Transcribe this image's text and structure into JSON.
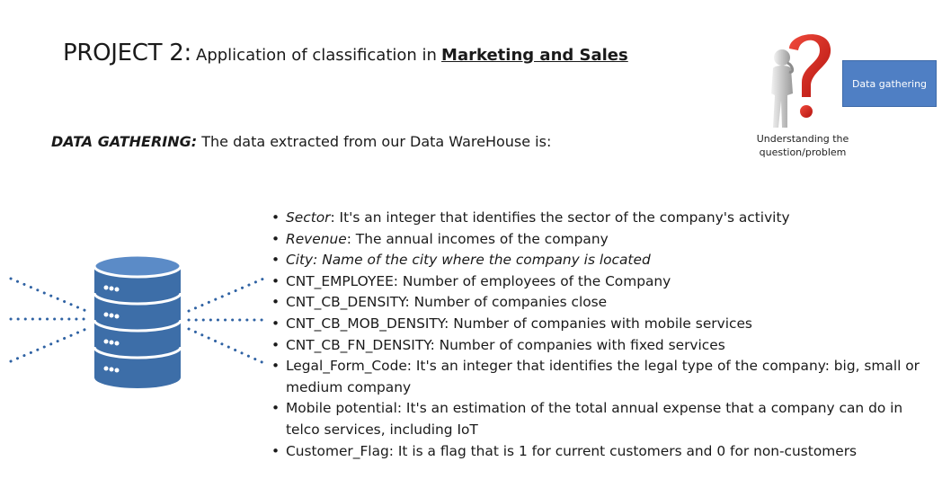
{
  "title": {
    "project": "PROJECT 2:",
    "prefix": "Application of classification in",
    "highlight": "Marketing and Sales"
  },
  "subtitle": {
    "lead": "DATA GATHERING:",
    "text": "The data extracted from our Data WareHouse is:"
  },
  "badge": {
    "label": "Data gathering"
  },
  "caption": {
    "line1": "Understanding the",
    "line2": "question/problem"
  },
  "colors": {
    "badge": "#4f7fc4",
    "database": "#3d6ea8",
    "question_mark": "#d7261e"
  },
  "icons": [
    "thinker-question-icon",
    "database-icon"
  ],
  "bullets": [
    {
      "term": "Sector",
      "text": ": It's an integer that identifies the sector of the company's activity"
    },
    {
      "term": "Revenue",
      "text": ": The annual incomes of the company"
    },
    {
      "term": "City: Name of the city where the company is located",
      "text": ""
    },
    {
      "term": "",
      "text": "CNT_EMPLOYEE: Number of employees of the Company"
    },
    {
      "term": "",
      "text": "CNT_CB_DENSITY: Number of companies close"
    },
    {
      "term": "",
      "text": "CNT_CB_MOB_DENSITY: Number of companies with mobile services"
    },
    {
      "term": "",
      "text": "CNT_CB_FN_DENSITY: Number of companies with fixed services"
    },
    {
      "term": "",
      "text": "Legal_Form_Code: It's an integer that identifies the legal type of the company: big, small or medium company"
    },
    {
      "term": "",
      "text": "Mobile potential: It's an estimation of the total annual expense that a company can do in telco services, including IoT"
    },
    {
      "term": "",
      "text": "Customer_Flag: It is a flag that is 1 for current customers and 0 for non-customers"
    }
  ]
}
